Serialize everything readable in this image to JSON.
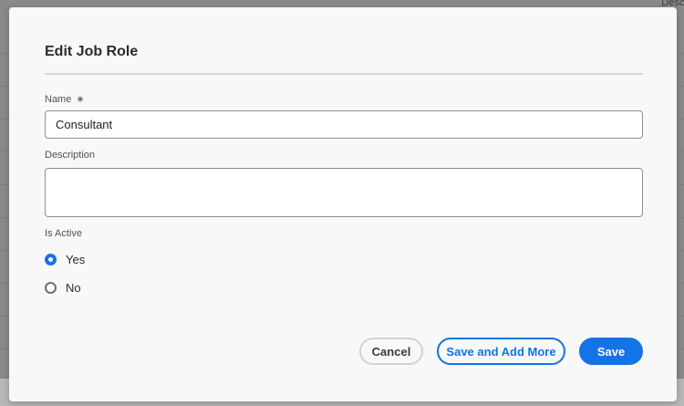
{
  "background": {
    "header_text": "Descr"
  },
  "dialog": {
    "title": "Edit Job Role",
    "name_field": {
      "label": "Name",
      "required_marker": "∗",
      "value": "Consultant"
    },
    "description_field": {
      "label": "Description",
      "value": ""
    },
    "is_active": {
      "label": "Is Active",
      "options": [
        {
          "label": "Yes",
          "selected": true
        },
        {
          "label": "No",
          "selected": false
        }
      ]
    },
    "buttons": {
      "cancel": "Cancel",
      "save_and_add_more": "Save and Add More",
      "save": "Save"
    }
  },
  "colors": {
    "accent": "#1473e6",
    "overlay": "#8a8a8a",
    "dialog_bg": "#f8f8f8"
  }
}
